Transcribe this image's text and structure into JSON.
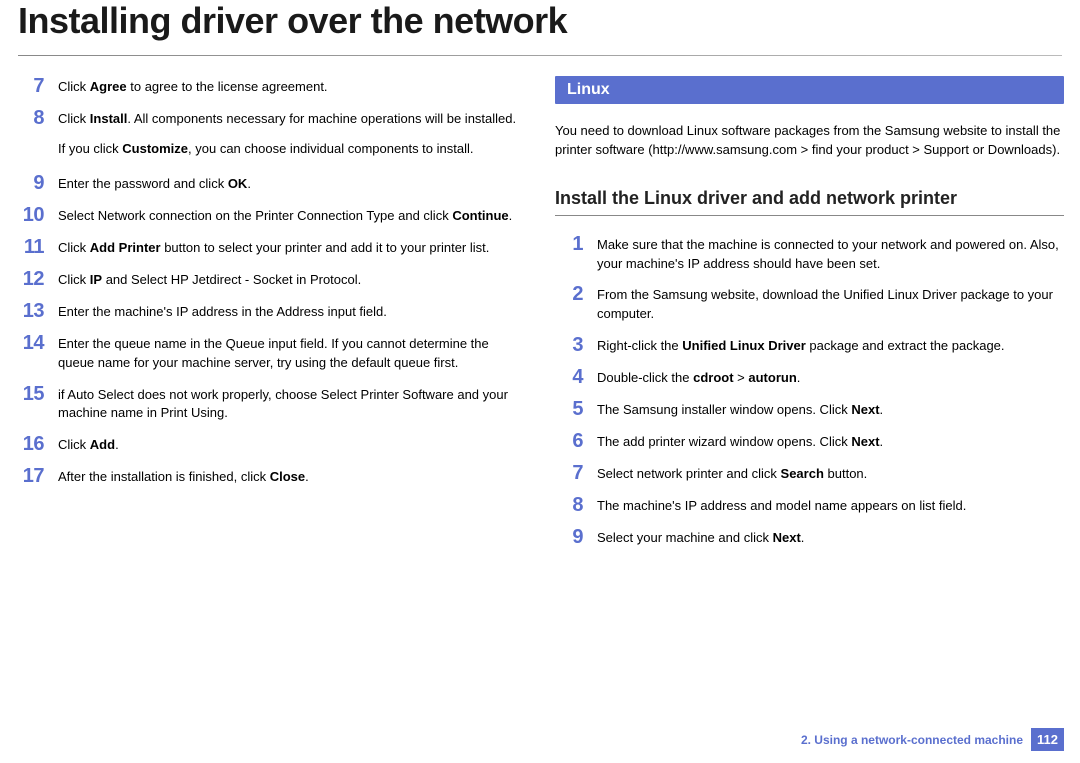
{
  "header": {
    "title": "Installing driver over the network"
  },
  "left": {
    "steps": [
      {
        "num": "7",
        "html": "Click <b>Agree</b> to agree to the license agreement."
      },
      {
        "num": "8",
        "html": "Click <b>Install</b>. All components necessary for machine operations will be installed.",
        "after": "If you click <b>Customize</b>, you can choose individual components to install."
      },
      {
        "num": "9",
        "html": "Enter the password and click <b>OK</b>."
      },
      {
        "num": "10",
        "html": "Select Network connection on the Printer Connection Type and click <b>Continue</b>."
      },
      {
        "num": "11",
        "html": "Click <b>Add Printer</b> button to select your printer and add it to your printer list."
      },
      {
        "num": "12",
        "html": "Click <b>IP</b> and Select HP Jetdirect - Socket in Protocol."
      },
      {
        "num": "13",
        "html": "Enter the machine's IP address in the Address input field."
      },
      {
        "num": "14",
        "html": "Enter the queue name in the Queue input field. If you cannot determine the queue name for your machine server, try using the default queue first."
      },
      {
        "num": "15",
        "html": "if Auto Select does not work properly, choose Select Printer Software and your machine name in Print Using."
      },
      {
        "num": "16",
        "html": "Click <b>Add</b>."
      },
      {
        "num": "17",
        "html": "After the installation is finished, click <b>Close</b>."
      }
    ]
  },
  "right": {
    "section_bar": "Linux",
    "intro": "You need to download Linux software packages from the Samsung website to install the printer software (http://www.samsung.com > find your product > Support or Downloads).",
    "subheading": "Install the Linux driver and add network printer",
    "steps": [
      {
        "num": "1",
        "html": "Make sure that the machine is connected to your network and powered on. Also, your machine's IP address should have been set."
      },
      {
        "num": "2",
        "html": "From the Samsung website, download the Unified Linux Driver package to your computer."
      },
      {
        "num": "3",
        "html": "Right-click the <b>Unified Linux Driver</b> package and extract the package."
      },
      {
        "num": "4",
        "html": "Double-click the <b>cdroot</b> > <b>autorun</b>."
      },
      {
        "num": "5",
        "html": "The Samsung installer window opens. Click <b>Next</b>."
      },
      {
        "num": "6",
        "html": "The add printer wizard window opens. Click <b>Next</b>."
      },
      {
        "num": "7",
        "html": "Select network printer and click <b>Search</b> button."
      },
      {
        "num": "8",
        "html": "The machine's IP address and model name appears on list field."
      },
      {
        "num": "9",
        "html": "Select your machine and click <b>Next</b>."
      }
    ]
  },
  "footer": {
    "chapter": "2.  Using a network-connected machine",
    "page": "112"
  }
}
